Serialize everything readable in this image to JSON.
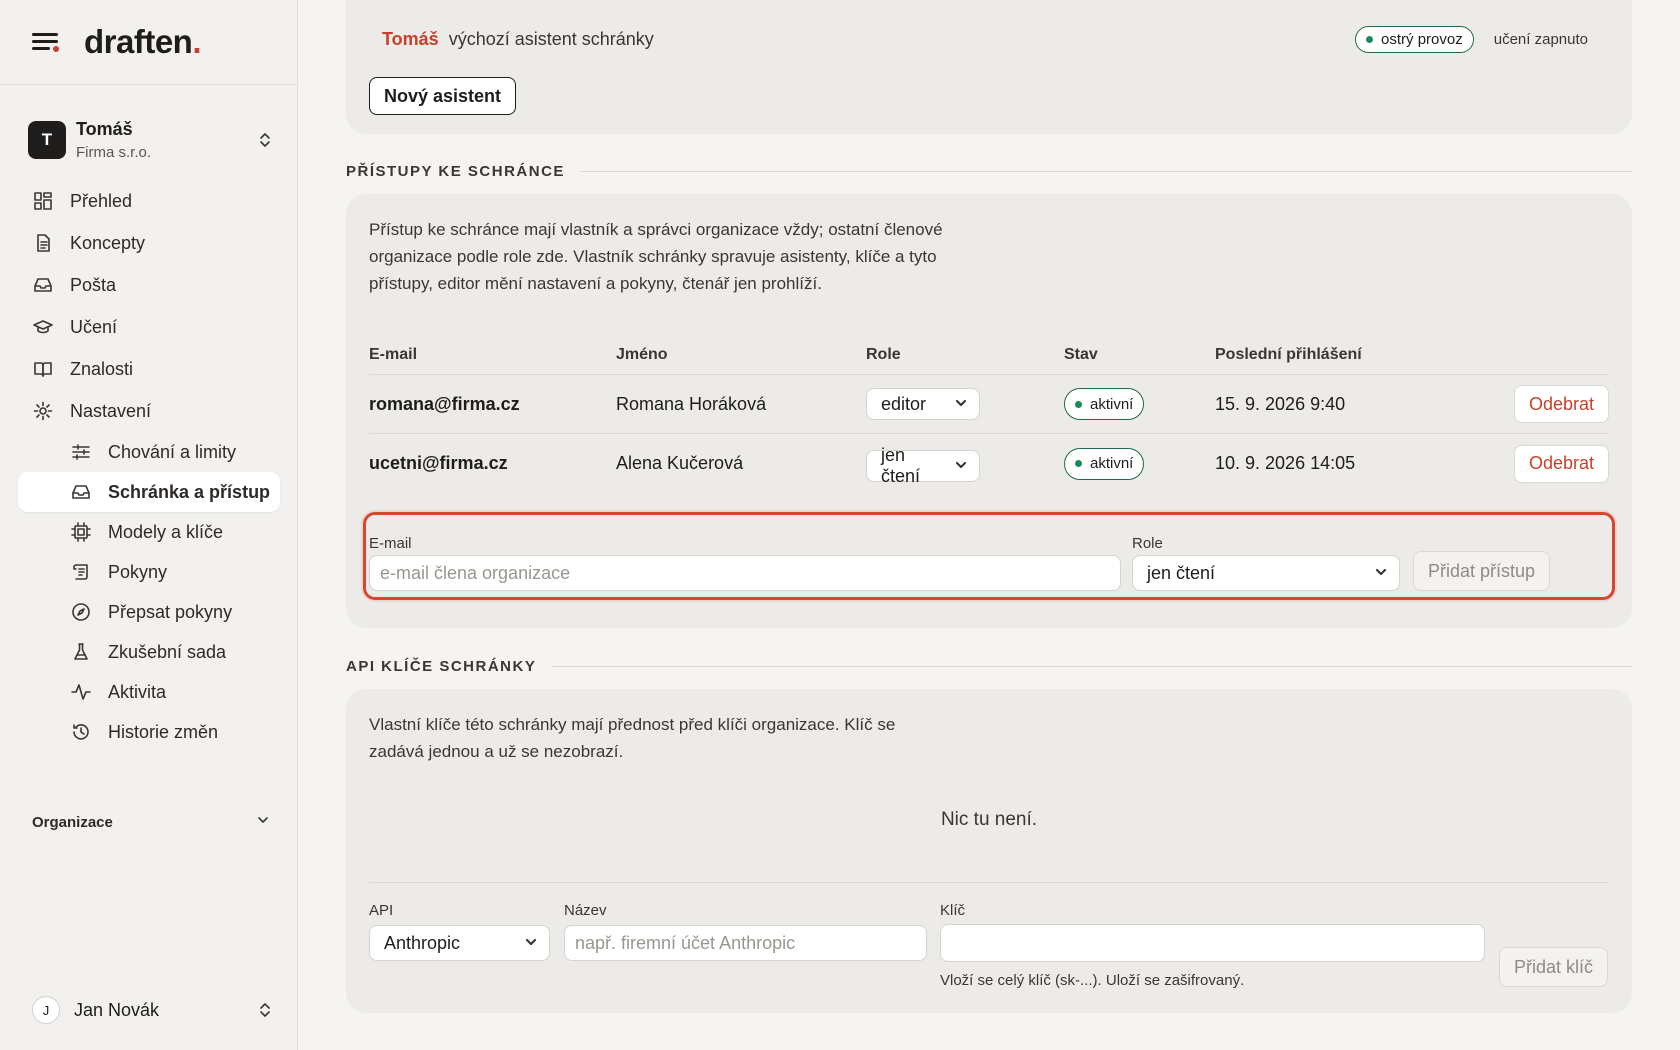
{
  "brand": {
    "name": "draften",
    "dot": "."
  },
  "org": {
    "initial": "T",
    "name": "Tomáš",
    "company": "Firma s.r.o."
  },
  "nav": {
    "items": [
      {
        "label": "Přehled"
      },
      {
        "label": "Koncepty"
      },
      {
        "label": "Pošta"
      },
      {
        "label": "Učení"
      },
      {
        "label": "Znalosti"
      },
      {
        "label": "Nastavení"
      }
    ],
    "subitems": [
      {
        "label": "Chování a limity"
      },
      {
        "label": "Schránka a přístup"
      },
      {
        "label": "Modely a klíče"
      },
      {
        "label": "Pokyny"
      },
      {
        "label": "Přepsat pokyny"
      },
      {
        "label": "Zkušební sada"
      },
      {
        "label": "Aktivita"
      },
      {
        "label": "Historie změn"
      }
    ],
    "section": "Organizace"
  },
  "user": {
    "initial": "J",
    "name": "Jan Novák"
  },
  "assistant": {
    "name": "Tomáš",
    "description": "výchozí asistent schránky",
    "status": "ostrý provoz",
    "learning": "učení zapnuto",
    "new_button": "Nový asistent"
  },
  "access": {
    "title": "PŘÍSTUPY KE SCHRÁNCE",
    "description": "Přístup ke schránce mají vlastník a správci organizace vždy; ostatní členové organizace podle role zde. Vlastník schránky spravuje asistenty, klíče a tyto přístupy, editor mění nastavení a pokyny, čtenář jen prohlíží.",
    "columns": {
      "email": "E-mail",
      "name": "Jméno",
      "role": "Role",
      "status": "Stav",
      "last_login": "Poslední přihlášení"
    },
    "rows": [
      {
        "email": "romana@firma.cz",
        "name": "Romana Horáková",
        "role": "editor",
        "status": "aktivní",
        "last_login": "15. 9. 2026 9:40",
        "action": "Odebrat"
      },
      {
        "email": "ucetni@firma.cz",
        "name": "Alena Kučerová",
        "role": "jen čtení",
        "status": "aktivní",
        "last_login": "10. 9. 2026 14:05",
        "action": "Odebrat"
      }
    ],
    "form": {
      "email_label": "E-mail",
      "email_placeholder": "e-mail člena organizace",
      "role_label": "Role",
      "role_value": "jen čtení",
      "submit": "Přidat přístup"
    }
  },
  "api_keys": {
    "title": "API KLÍČE SCHRÁNKY",
    "description": "Vlastní klíče této schránky mají přednost před klíči organizace. Klíč se zadává jednou a už se nezobrazí.",
    "empty": "Nic tu není.",
    "form": {
      "api_label": "API",
      "api_value": "Anthropic",
      "name_label": "Název",
      "name_placeholder": "např. firemní účet Anthropic",
      "key_label": "Klíč",
      "key_hint": "Vloží se celý klíč (sk-...). Uloží se zašifrovaný.",
      "submit": "Přidat klíč"
    }
  },
  "colors": {
    "accent": "#c8412b",
    "success": "#1d8a5a",
    "bg": "#f5f4f2",
    "card": "#ecebe8"
  }
}
